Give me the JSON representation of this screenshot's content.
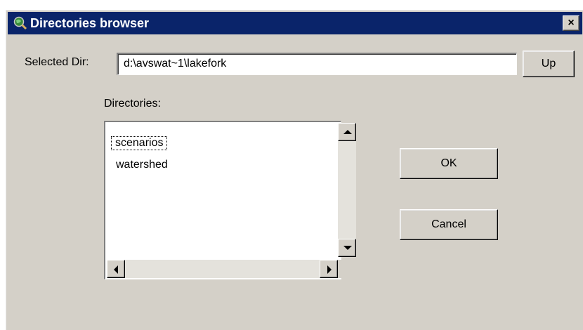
{
  "window": {
    "title": "Directories browser",
    "close_glyph": "×"
  },
  "selected_dir": {
    "label": "Selected Dir:",
    "value": "d:\\avswat~1\\lakefork"
  },
  "buttons": {
    "up": "Up",
    "ok": "OK",
    "cancel": "Cancel"
  },
  "directories": {
    "label": "Directories:",
    "items": [
      "scenarios",
      "watershed"
    ],
    "focused_index": 0
  },
  "icons": {
    "app": "magnifier-globe-icon",
    "close": "close-icon",
    "scroll_up": "arrow-up-icon",
    "scroll_down": "arrow-down-icon",
    "scroll_left": "arrow-left-icon",
    "scroll_right": "arrow-right-icon"
  },
  "colors": {
    "titlebar": "#0a246a",
    "face": "#d4d0c8",
    "field": "#ffffff"
  }
}
